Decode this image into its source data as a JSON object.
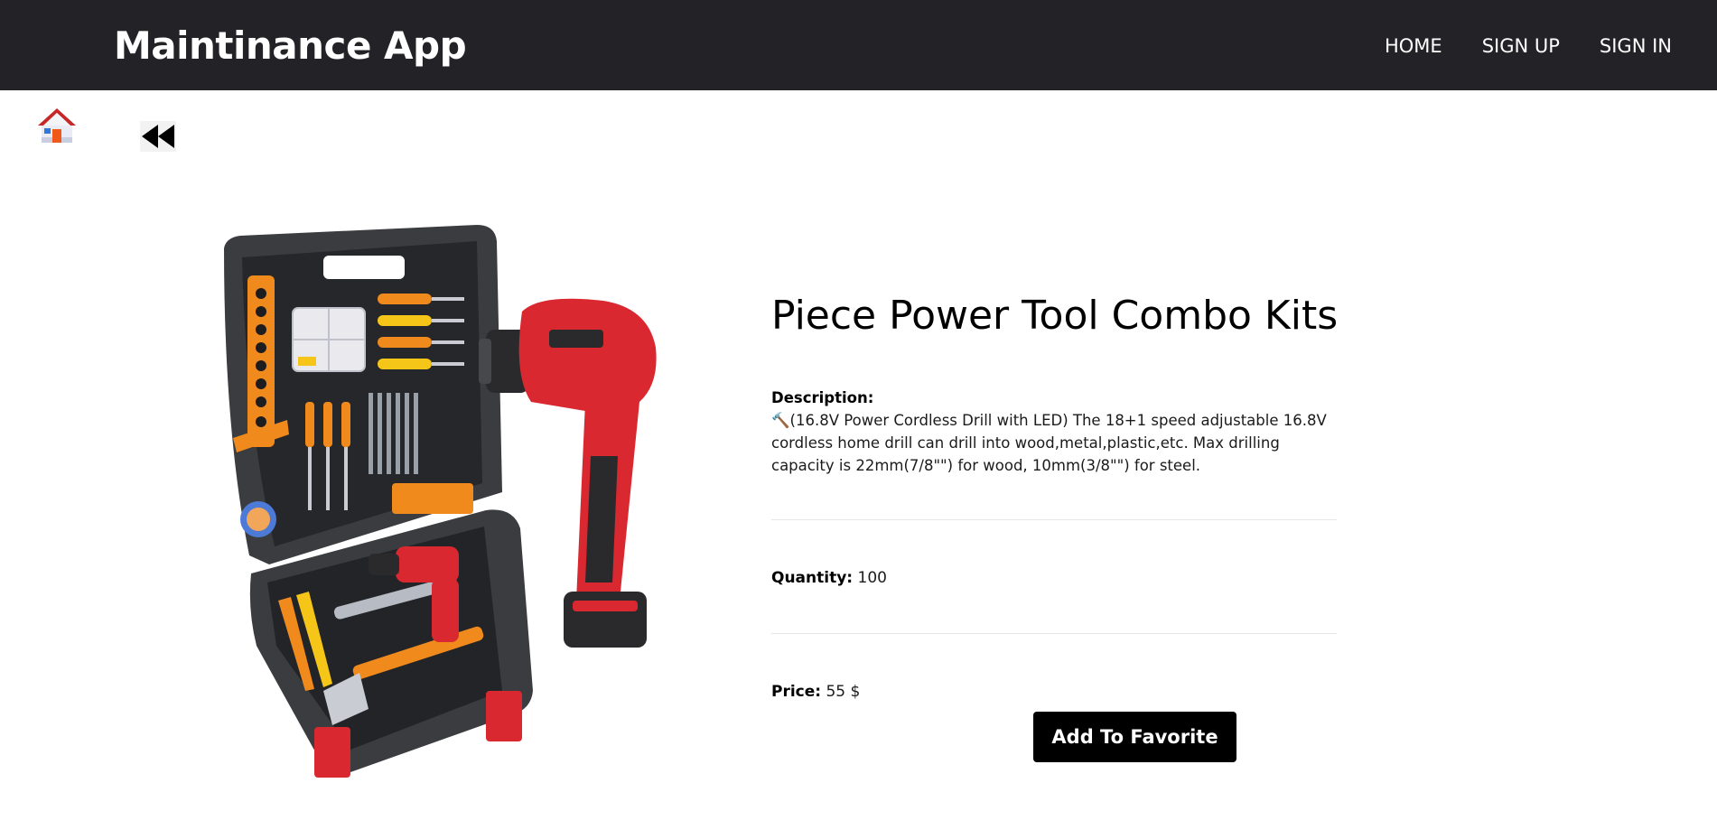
{
  "header": {
    "brand": "Maintinance App",
    "nav": [
      {
        "label": "HOME"
      },
      {
        "label": "SIGN UP"
      },
      {
        "label": "SIGN IN"
      }
    ]
  },
  "toolbar": {
    "home_icon": "house-icon",
    "back_icon": "rewind-icon"
  },
  "product": {
    "title": "Piece Power Tool Combo Kits",
    "image_icon": "power-tool-kit-image",
    "description_label": "Description:",
    "description": "🔨(16.8V Power Cordless Drill with LED) The 18+1 speed adjustable 16.8V cordless home drill can drill into wood,metal,plastic,etc. Max drilling capacity is 22mm(7/8\"\") for wood, 10mm(3/8\"\") for steel.",
    "quantity_label": "Quantity:",
    "quantity": "100",
    "price_label": "Price:",
    "price": "55 $",
    "favorite_button": "Add To Favorite"
  },
  "colors": {
    "navbar": "#232226",
    "button": "#000000",
    "drill_red": "#d9282f",
    "accent_orange": "#f08a1c"
  }
}
